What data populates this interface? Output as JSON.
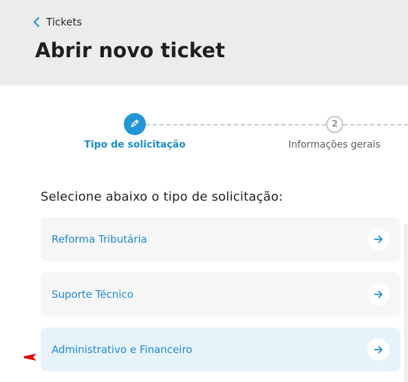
{
  "header": {
    "back_label": "Tickets",
    "title": "Abrir novo ticket"
  },
  "stepper": {
    "steps": [
      {
        "label": "Tipo de solicitação",
        "state": "active",
        "icon": "pencil-icon"
      },
      {
        "label": "Informações gerais",
        "state": "inactive",
        "number": "2"
      }
    ]
  },
  "section": {
    "title": "Selecione abaixo o tipo de solicitação:"
  },
  "options": [
    {
      "label": "Reforma Tributária",
      "selected": false
    },
    {
      "label": "Suporte Técnico",
      "selected": false
    },
    {
      "label": "Administrativo e Financeiro",
      "selected": true
    }
  ],
  "colors": {
    "accent": "#2196d9",
    "link_text": "#1f8ad0",
    "header_bg": "#ececec",
    "card_bg": "#f6f6f6",
    "card_selected_bg": "#e6f3fb",
    "pointer": "#e00000"
  }
}
